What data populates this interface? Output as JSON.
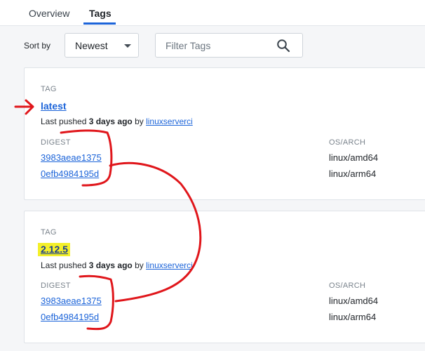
{
  "tabs": [
    {
      "label": "Overview",
      "active": false
    },
    {
      "label": "Tags",
      "active": true
    }
  ],
  "controls": {
    "sort_label": "Sort by",
    "sort_value": "Newest",
    "filter_placeholder": "Filter Tags"
  },
  "tags": [
    {
      "section_label": "TAG",
      "name": "latest",
      "pushed_prefix": "Last pushed ",
      "pushed_time": "3 days ago",
      "pushed_by": " by ",
      "pusher": "linuxserverci",
      "digest_header": "DIGEST",
      "osarch_header": "OS/ARCH",
      "digests": [
        {
          "digest": "3983aeae1375",
          "osarch": "linux/amd64"
        },
        {
          "digest": "0efb4984195d",
          "osarch": "linux/arm64"
        }
      ]
    },
    {
      "section_label": "TAG",
      "name": "2.12.5",
      "pushed_prefix": "Last pushed ",
      "pushed_time": "3 days ago",
      "pushed_by": " by ",
      "pusher": "linuxserverci",
      "digest_header": "DIGEST",
      "osarch_header": "OS/ARCH",
      "digests": [
        {
          "digest": "3983aeae1375",
          "osarch": "linux/amd64"
        },
        {
          "digest": "0efb4984195d",
          "osarch": "linux/arm64"
        }
      ]
    }
  ],
  "colors": {
    "link": "#1c64d9",
    "annotation_red": "#e0161b",
    "highlight_yellow": "#f4f029"
  }
}
